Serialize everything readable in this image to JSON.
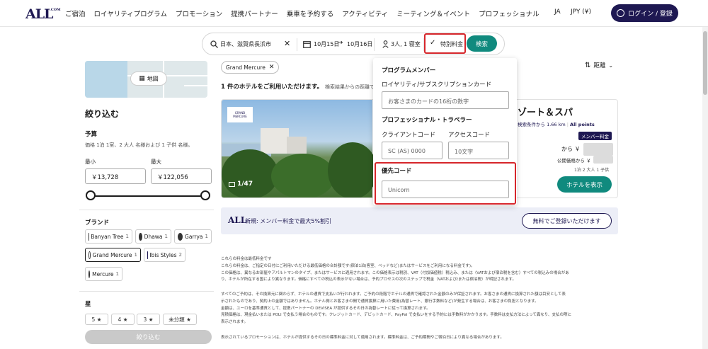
{
  "header": {
    "logo": "ALL",
    "logo_sub": ".COM",
    "nav": [
      "ご宿泊",
      "ロイヤリティプログラム",
      "プロモーション",
      "提携パートナー",
      "乗車を予約する",
      "アクティビティ",
      "ミーティング＆イベント",
      "プロフェッショナル"
    ],
    "language": "JA",
    "currency": "JPY (¥)",
    "login_label": "ログイン / 登録"
  },
  "search": {
    "destination": "日本、滋賀県長浜市",
    "date_from": "10月15日",
    "date_to": "10月16日",
    "guests": "3人, 1 寝室",
    "special_rate": "特別料金",
    "search_label": "検索"
  },
  "sidebar": {
    "map_label": "地図",
    "refine_title": "絞り込む",
    "budget_label": "予算",
    "budget_note": "価格 1泊 1室、2 大人 名様および 1 子供 名様。",
    "min_label": "最小",
    "max_label": "最大",
    "min_value": "￥13,728",
    "max_value": "￥122,056",
    "brand_label": "ブランド",
    "brands": [
      {
        "name": "Banyan Tree",
        "count": "1"
      },
      {
        "name": "Dhawa",
        "count": "1"
      },
      {
        "name": "Garrya",
        "count": "1"
      },
      {
        "name": "Grand Mercure",
        "count": "1"
      },
      {
        "name": "Ibis Styles",
        "count": "2"
      },
      {
        "name": "Mercure",
        "count": "1"
      }
    ],
    "stars_label": "星",
    "stars": [
      "5 ★",
      "4 ★",
      "3 ★",
      "未分類 ★"
    ],
    "refine_button": "絞り込む"
  },
  "results": {
    "active_filter": "Grand Mercure",
    "count_text": "1 件のホテルをご利用いただけます。",
    "count_note": "検索結果からの距離で並べ",
    "sort_label": "距離",
    "hotel": {
      "image_counter": "1/47",
      "name": "ゾート＆スパ",
      "distance": "検索条件から 1.66 km",
      "points": "All points",
      "member_rate": "メンバー料金",
      "from": "から ￥",
      "public_price": "公開価格から ￥",
      "room_info": "1泊 2 大人 1 子供",
      "button": "ホテルを表示"
    },
    "promo": {
      "logo": "ALL",
      "text": "新規: メンバー料金で最大5%割引",
      "button": "無料でご登録いただけます"
    },
    "disclaimer_1": [
      "これらの料金は最低料金です",
      "これらの料金は、ご指定の日付にご利用いただける最低価格の合計額です(宿泊1泊(客室、ベッドなど)またはサービスをご利用になる料金です)。",
      "この価格は、異なるお部屋やアパルトマンのタイプ、またはサービスに適用されます。この価格表示は税別、VAT（付加価値税）税込み、または（VATおよび宿泊税を含む）すべての税込みの場合があ",
      "り、ホテルが所在する国により異なります。価格にすべての税込の表示がない場合は、予約プロセスの次のステップで税金（VATおよび/または宿泊税）が明記されます。"
    ],
    "disclaimer_2": [
      "すべてのご予約は、その換算元に関わらず、ホテルの通貨で支払いが行われます。ご予約の段階でホテルの通貨で確認された金額のみが保証されます。お客さまの通貨に換算された額は目安として表",
      "示されたものであり、契約上の金額ではありません。ホテル側とお客さまの間で通貨換算に用いた費用(為替レート、銀行手数料など)が発生する場合は、お客さまの負担となります。",
      "金額は、ユーロを基準通貨として、提携パートナーの DEVISEA が提供するその日の為替レートに従って換算されます。",
      "見積価格は、現金払いまたは POLI で支払う場合のものです。クレジットカード、デビットカード、PayPal で支払いをする予約には手数料がかかります。手数料は支払方法によって異なり、支払の際に",
      "表示されます。"
    ],
    "disclaimer_3": [
      "表示されているプロモーションは、ホテルが提供するその日の標準料金に対して適用されます。標準料金は、ご予約期間やご宿泊日により異なる場合があります。"
    ]
  },
  "rates_panel": {
    "program_member": "プログラムメンバー",
    "card_label": "ロイヤリティ/サブスクリプションカード",
    "card_placeholder": "お客さまのカードの16桁の数字",
    "professional": "プロフェッショナル・トラベラー",
    "client_code_label": "クライアントコード",
    "access_code_label": "アクセスコード",
    "client_code_placeholder": "SC (AS) 0000",
    "access_code_placeholder": "10文字",
    "preferred_code_label": "優先コード",
    "preferred_code_placeholder": "Unicorn"
  },
  "colors": {
    "brand_navy": "#1e1852",
    "teal": "#108a7e",
    "highlight_red": "#d6262b"
  }
}
